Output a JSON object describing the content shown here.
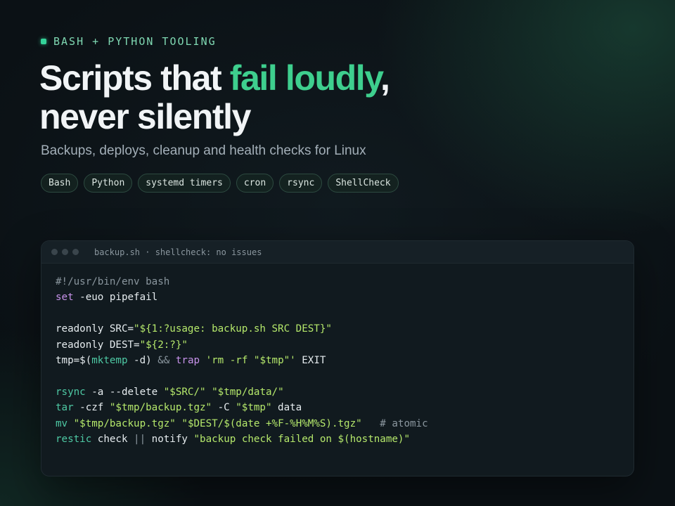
{
  "eyebrow": {
    "text": "BASH + PYTHON TOOLING"
  },
  "headline": {
    "part1": "Scripts that ",
    "accent": "fail loudly",
    "part2": ",",
    "line2": "never silently"
  },
  "subtitle": "Backups, deploys, cleanup and health checks for Linux",
  "tags": [
    "Bash",
    "Python",
    "systemd timers",
    "cron",
    "rsync",
    "ShellCheck"
  ],
  "terminal": {
    "title": "backup.sh · shellcheck: no issues",
    "lines": [
      [
        [
          "c-comment",
          "#!/usr/bin/env bash"
        ]
      ],
      [
        [
          "c-kw",
          "set"
        ],
        [
          "c-plain",
          " -euo pipefail"
        ]
      ],
      [],
      [
        [
          "c-plain",
          "readonly SRC="
        ],
        [
          "c-str",
          "\"${1:?usage: backup.sh SRC DEST}\""
        ]
      ],
      [
        [
          "c-plain",
          "readonly DEST="
        ],
        [
          "c-str",
          "\"${2:?}\""
        ]
      ],
      [
        [
          "c-plain",
          "tmp=$("
        ],
        [
          "c-cmd",
          "mktemp"
        ],
        [
          "c-plain",
          " -d) "
        ],
        [
          "c-op",
          "&&"
        ],
        [
          "c-plain",
          " "
        ],
        [
          "c-kw",
          "trap"
        ],
        [
          "c-plain",
          " "
        ],
        [
          "c-str",
          "'rm -rf \"$tmp\"'"
        ],
        [
          "c-plain",
          " EXIT"
        ]
      ],
      [],
      [
        [
          "c-cmd",
          "rsync"
        ],
        [
          "c-plain",
          " -a --delete "
        ],
        [
          "c-str",
          "\"$SRC/\""
        ],
        [
          "c-plain",
          " "
        ],
        [
          "c-str",
          "\"$tmp/data/\""
        ]
      ],
      [
        [
          "c-cmd",
          "tar"
        ],
        [
          "c-plain",
          " -czf "
        ],
        [
          "c-str",
          "\"$tmp/backup.tgz\""
        ],
        [
          "c-plain",
          " -C "
        ],
        [
          "c-str",
          "\"$tmp\""
        ],
        [
          "c-plain",
          " data"
        ]
      ],
      [
        [
          "c-cmd",
          "mv"
        ],
        [
          "c-plain",
          " "
        ],
        [
          "c-str",
          "\"$tmp/backup.tgz\""
        ],
        [
          "c-plain",
          " "
        ],
        [
          "c-str",
          "\"$DEST/$(date +%F-%H%M%S).tgz\""
        ],
        [
          "c-plain",
          "   "
        ],
        [
          "c-comment",
          "# atomic"
        ]
      ],
      [
        [
          "c-cmd",
          "restic"
        ],
        [
          "c-plain",
          " check "
        ],
        [
          "c-op",
          "||"
        ],
        [
          "c-plain",
          " notify "
        ],
        [
          "c-str",
          "\"backup check failed on $(hostname)\""
        ]
      ]
    ]
  },
  "colors": {
    "accent": "#3ecf8e",
    "background": "#0b1115",
    "keyword": "#c792ea",
    "command": "#4ec9a4",
    "string": "#b5e86b",
    "comment": "#8a969e"
  }
}
